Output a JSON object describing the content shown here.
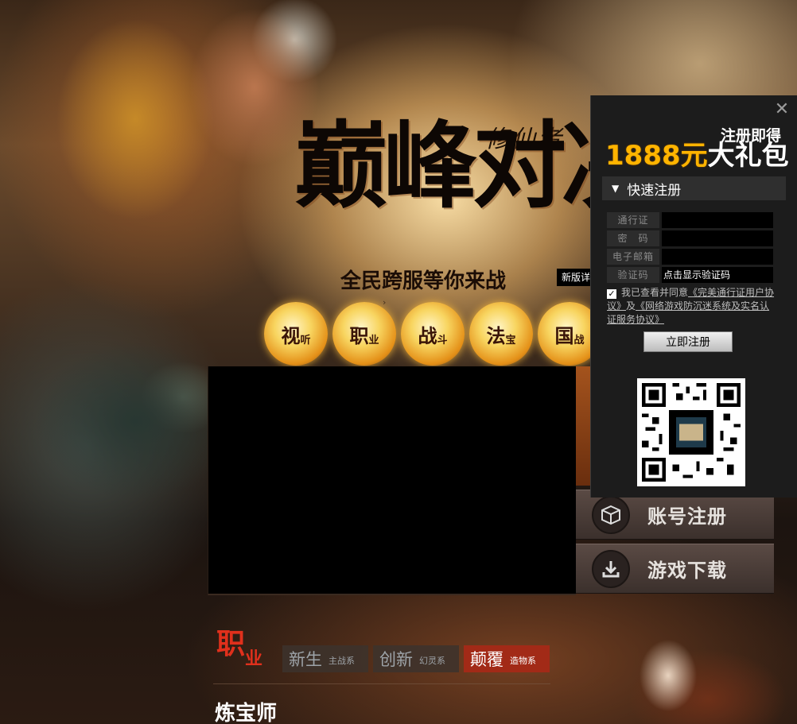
{
  "banner": {
    "game_name": "修仙者",
    "main_title": "巅峰对决",
    "slogan": "全民跨服等你来战",
    "news_tag": "新版详"
  },
  "features": [
    {
      "big": "视",
      "small": "听"
    },
    {
      "big": "职",
      "small": "业"
    },
    {
      "big": "战",
      "small": "斗"
    },
    {
      "big": "法",
      "small": "宝"
    },
    {
      "big": "国",
      "small": "战"
    }
  ],
  "side_buttons": {
    "register": {
      "label": "账号注册",
      "icon": "cube-icon"
    },
    "download": {
      "label": "游戏下载",
      "icon": "download-icon"
    }
  },
  "classes": {
    "title_main": "职",
    "title_sub": "业",
    "tabs": [
      {
        "main": "新生",
        "tag": "主战系"
      },
      {
        "main": "创新",
        "tag": "幻灵系"
      },
      {
        "main": "颠覆",
        "tag": "造物系"
      }
    ],
    "active_tab_index": 2,
    "current_class": "炼宝师"
  },
  "register_panel": {
    "close_icon": "close-icon",
    "promo_line1": "注册即得",
    "promo_amount": "1888元",
    "promo_gift": "大礼包",
    "header": "快速注册",
    "fields": {
      "account_label": "通行证",
      "password_label": "密　码",
      "email_label": "电子邮箱",
      "captcha_label": "验证码",
      "captcha_text": "点击显示验证码"
    },
    "agree": {
      "checked": true,
      "prefix": "我已查看并同意",
      "link1": "《完美通行证用户协议》",
      "mid": "及",
      "link2": "《网络游戏防沉迷系统及实名认证服务协议》"
    },
    "submit_label": "立即注册"
  },
  "colors": {
    "accent_gold": "#ffb400",
    "active_tab": "#a22a17",
    "panel_bg": "#1c1c1c"
  }
}
